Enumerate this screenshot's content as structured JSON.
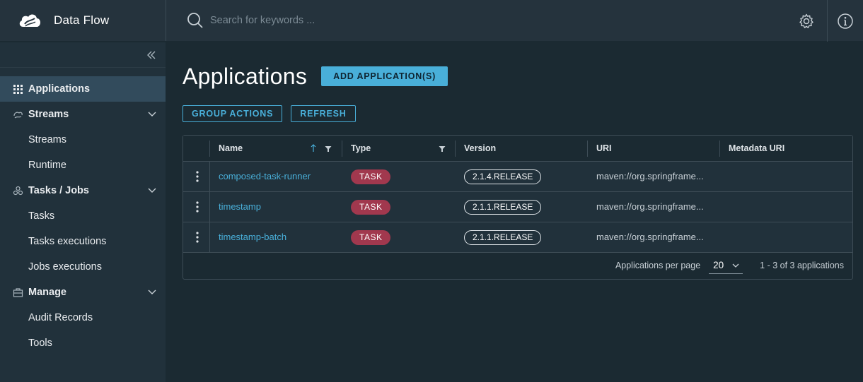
{
  "header": {
    "brand_title": "Data Flow",
    "search_placeholder": "Search for keywords ...",
    "icons": {
      "logo": "spring-cloud-logo",
      "search": "search-icon",
      "settings": "gear-icon",
      "info": "info-icon"
    }
  },
  "sidebar": {
    "collapse_icon": "double-chevron-left-icon",
    "items": [
      {
        "label": "Applications",
        "icon": "grid-icon",
        "active": true
      },
      {
        "label": "Streams",
        "icon": "streams-icon",
        "group": true
      },
      {
        "label": "Streams"
      },
      {
        "label": "Runtime"
      },
      {
        "label": "Tasks / Jobs",
        "icon": "tasks-icon",
        "group": true
      },
      {
        "label": "Tasks"
      },
      {
        "label": "Tasks executions"
      },
      {
        "label": "Jobs executions"
      },
      {
        "label": "Manage",
        "icon": "briefcase-icon",
        "group": true
      },
      {
        "label": "Audit Records"
      },
      {
        "label": "Tools"
      }
    ]
  },
  "main": {
    "title": "Applications",
    "add_button": "ADD APPLICATION(S)",
    "group_actions_button": "GROUP ACTIONS",
    "refresh_button": "REFRESH",
    "table": {
      "columns": [
        "Name",
        "Type",
        "Version",
        "URI",
        "Metadata URI"
      ],
      "rows": [
        {
          "name": "composed-task-runner",
          "type": "TASK",
          "version": "2.1.4.RELEASE",
          "uri": "maven://org.springframe...",
          "metadata_uri": ""
        },
        {
          "name": "timestamp",
          "type": "TASK",
          "version": "2.1.1.RELEASE",
          "uri": "maven://org.springframe...",
          "metadata_uri": ""
        },
        {
          "name": "timestamp-batch",
          "type": "TASK",
          "version": "2.1.1.RELEASE",
          "uri": "maven://org.springframe...",
          "metadata_uri": ""
        }
      ],
      "per_page_label": "Applications per page",
      "per_page_value": "20",
      "range_label": "1 - 3 of 3 applications"
    }
  },
  "colors": {
    "accent": "#49afd9",
    "task_badge": "#a1384e",
    "background": "#1b2a32",
    "sidebar": "#21313b",
    "header": "#25333d"
  }
}
